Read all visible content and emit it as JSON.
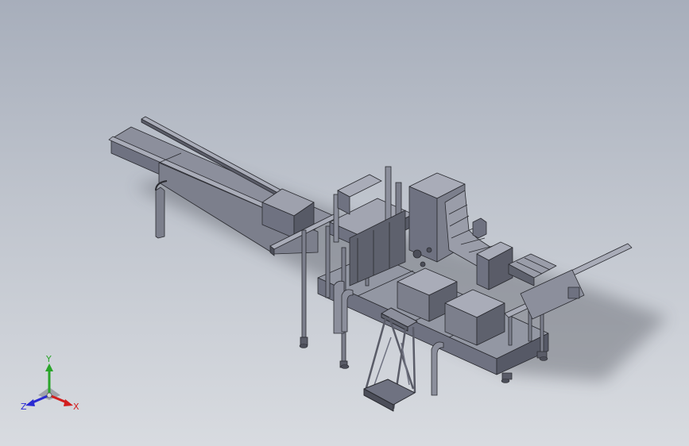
{
  "viewport": {
    "background_top": "#a7aebb",
    "background_bottom": "#d8dbe0"
  },
  "model": {
    "body_color": "#8c8f9c",
    "shade_color": "#6f7281",
    "dark_color": "#4c4e59",
    "light_color": "#a9acb8",
    "edge_color": "#2a2b30"
  },
  "triad": {
    "x_label": "X",
    "y_label": "Y",
    "z_label": "Z",
    "x_color": "#d21e1e",
    "y_color": "#2aa52a",
    "z_color": "#2a2ad2"
  }
}
